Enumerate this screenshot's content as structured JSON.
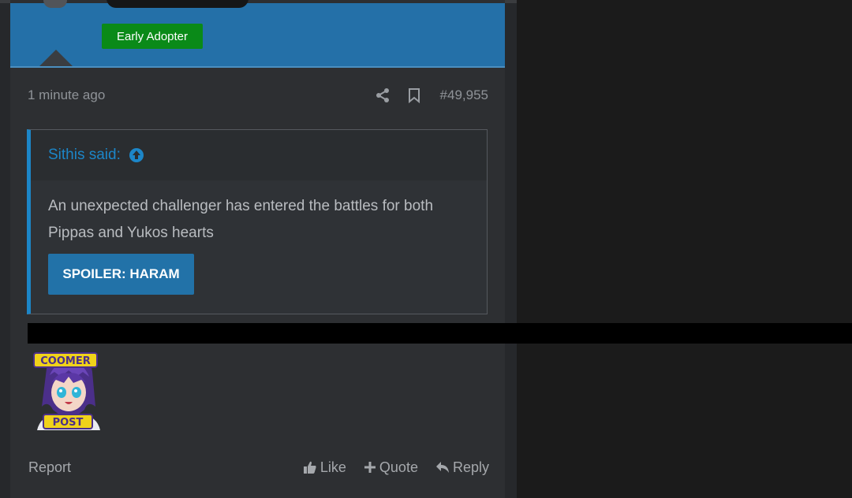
{
  "post": {
    "user_badge": "Early Adopter",
    "timestamp": "1 minute ago",
    "post_number": "#49,955",
    "share_icon": "share-icon",
    "bookmark_icon": "bookmark-icon"
  },
  "quote": {
    "author": "Sithis said:",
    "jump_icon": "arrow-up-circle-icon",
    "text": "An unexpected challenger has entered the battles for both Pippas and Yukos hearts",
    "spoiler_button": "SPOILER: HARAM"
  },
  "sticker": {
    "top_text": "COOMER",
    "bottom_text": "POST"
  },
  "actions": {
    "report": "Report",
    "like": "Like",
    "quote": "Quote",
    "reply": "Reply"
  },
  "colors": {
    "banner": "#2470a8",
    "badge": "#0a8a18",
    "accent": "#1c86c8",
    "post_bg": "#2d2f32"
  }
}
